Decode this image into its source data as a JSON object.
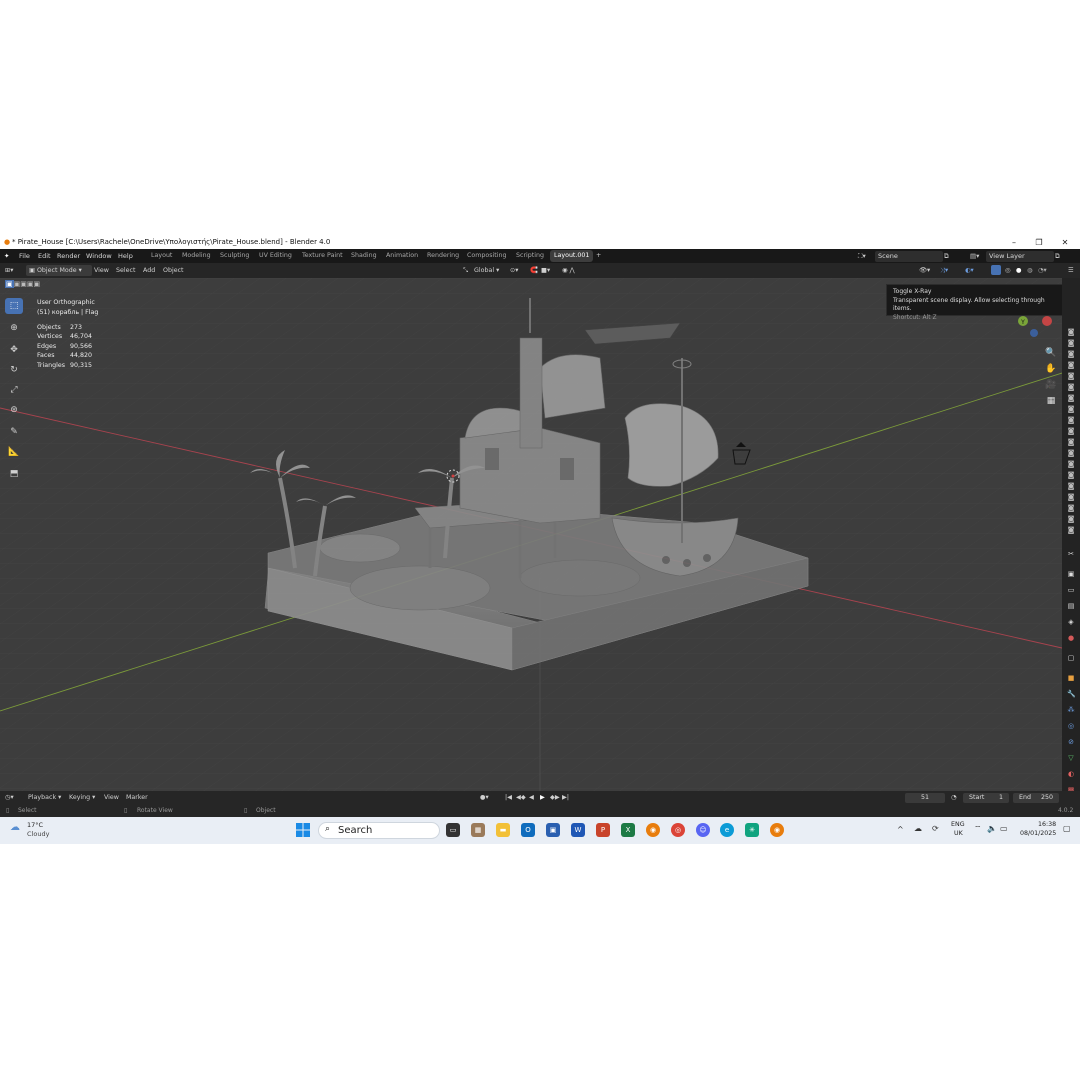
{
  "window": {
    "title": "* Pirate_House [C:\\Users\\Rachele\\OneDrive\\Υπολογιστής\\Pirate_House.blend] - Blender 4.0",
    "minimize": "–",
    "maximize": "❐",
    "close": "✕"
  },
  "menu": {
    "items": [
      "File",
      "Edit",
      "Render",
      "Window",
      "Help"
    ]
  },
  "workspaces": {
    "tabs": [
      "Layout",
      "Modeling",
      "Sculpting",
      "UV Editing",
      "Texture Paint",
      "Shading",
      "Animation",
      "Rendering",
      "Compositing",
      "Scripting",
      "Layout.001"
    ],
    "active": "Layout.001",
    "add": "+"
  },
  "scene": {
    "label": "Scene",
    "view_layer": "View Layer"
  },
  "viewport_header": {
    "mode": "Object Mode",
    "menus": [
      "View",
      "Select",
      "Add",
      "Object"
    ],
    "transform_orientation": "Global"
  },
  "overlay_info": {
    "view_name": "User Orthographic",
    "active_object": "(51) корабль | Flag",
    "stats": [
      {
        "label": "Objects",
        "value": "273"
      },
      {
        "label": "Vertices",
        "value": "46,704"
      },
      {
        "label": "Edges",
        "value": "90,566"
      },
      {
        "label": "Faces",
        "value": "44,820"
      },
      {
        "label": "Triangles",
        "value": "90,315"
      }
    ]
  },
  "tooltip": {
    "title": "Toggle X-Ray",
    "description": "Transparent scene display. Allow selecting through items.",
    "shortcut": "Shortcut: Alt Z"
  },
  "timeline": {
    "menus": [
      "Playback",
      "Keying",
      "View",
      "Marker"
    ],
    "current_frame": "51",
    "start_label": "Start",
    "start": "1",
    "end_label": "End",
    "end": "250"
  },
  "statusbar": {
    "select": "Select",
    "rotate_view": "Rotate View",
    "object": "Object",
    "version": "4.0.2"
  },
  "taskbar": {
    "weather_temp": "17°C",
    "weather_desc": "Cloudy",
    "search_placeholder": "Search",
    "lang_top": "ENG",
    "lang_bottom": "UK",
    "time": "16:38",
    "date": "08/01/2025"
  }
}
